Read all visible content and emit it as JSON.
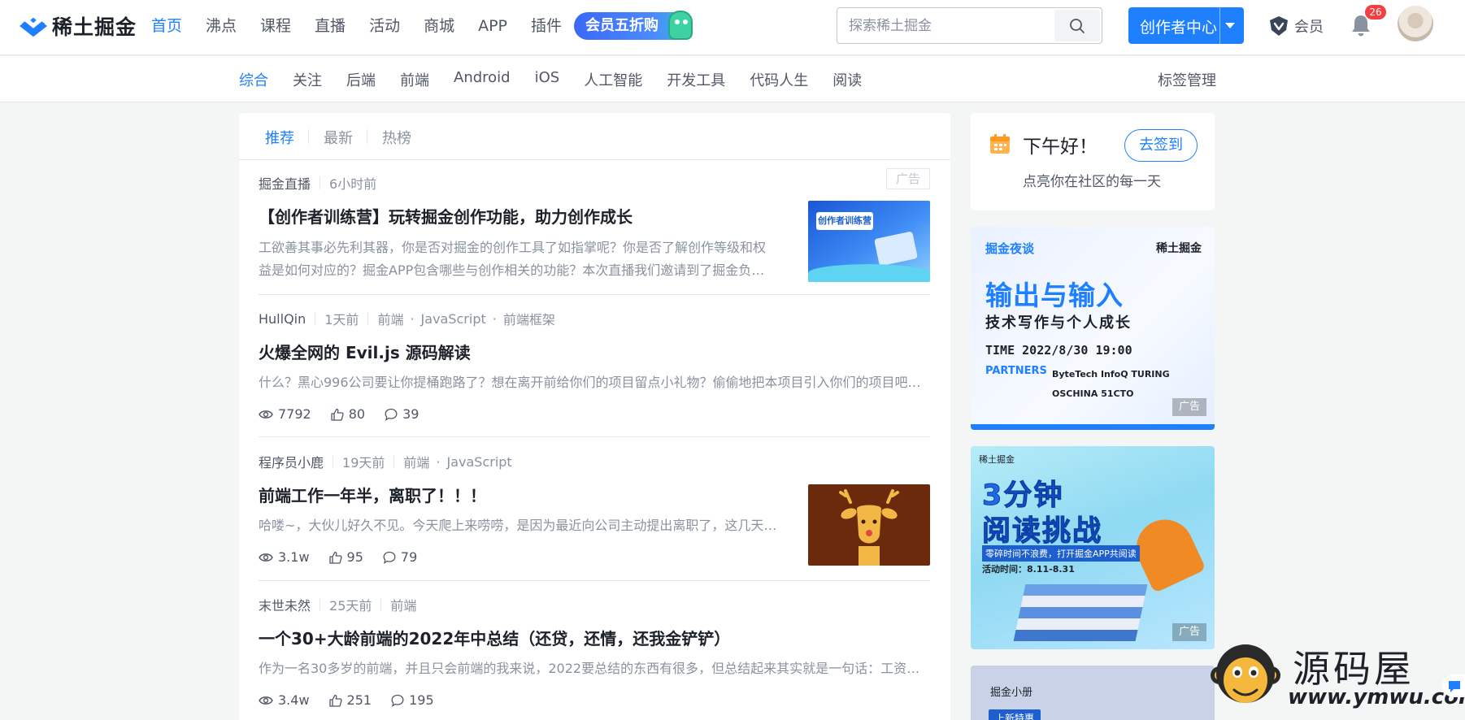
{
  "brand": {
    "name": "稀土掘金",
    "accent": "#1e80ff"
  },
  "main_nav": [
    {
      "label": "首页",
      "active": true
    },
    {
      "label": "沸点"
    },
    {
      "label": "课程"
    },
    {
      "label": "直播"
    },
    {
      "label": "活动"
    },
    {
      "label": "商城"
    },
    {
      "label": "APP"
    },
    {
      "label": "插件"
    }
  ],
  "promo": {
    "label": "会员五折购"
  },
  "search": {
    "placeholder": "探索稀土掘金",
    "icon": "search-icon"
  },
  "creator": {
    "label": "创作者中心"
  },
  "member": {
    "label": "会员"
  },
  "notifications": {
    "count": "26"
  },
  "sub_nav": {
    "items": [
      {
        "label": "综合",
        "active": true
      },
      {
        "label": "关注"
      },
      {
        "label": "后端"
      },
      {
        "label": "前端"
      },
      {
        "label": "Android"
      },
      {
        "label": "iOS"
      },
      {
        "label": "人工智能"
      },
      {
        "label": "开发工具"
      },
      {
        "label": "代码人生"
      },
      {
        "label": "阅读"
      }
    ],
    "manage": "标签管理"
  },
  "feed": {
    "tabs": [
      {
        "label": "推荐",
        "active": true
      },
      {
        "label": "最新"
      },
      {
        "label": "热榜"
      }
    ],
    "entries": [
      {
        "author": "掘金直播",
        "time": "6小时前",
        "ad": "广告",
        "title": "【创作者训练营】玩转掘金创作功能，助力创作成长",
        "abstract_line1": "工欲善其事必先利其器，你是否对掘金的创作工具了如指掌呢？你是否了解创作等级和权",
        "abstract_line2": "益是如何对应的？掘金APP包含哪些与创作相关的功能？本次直播我们邀请到了掘金负…"
      },
      {
        "author": "HullQin",
        "time": "1天前",
        "tags": [
          "前端",
          "JavaScript",
          "前端框架"
        ],
        "title": "火爆全网的 Evil.js 源码解读",
        "abstract_line1": "什么？黑心996公司要让你提桶跑路了？想在离开前给你们的项目留点小礼物？偷偷地把本项目引入你们的项目吧…",
        "views": "7792",
        "likes": "80",
        "comments": "39"
      },
      {
        "author": "程序员小鹿",
        "time": "19天前",
        "tags": [
          "前端",
          "JavaScript"
        ],
        "title": "前端工作一年半，离职了！！！",
        "abstract_line1": "哈喽~，大伙儿好久不见。今天爬上来唠唠，是因为最近向公司主动提出离职了，这几天…",
        "views": "3.1w",
        "likes": "95",
        "comments": "79"
      },
      {
        "author": "末世未然",
        "time": "25天前",
        "tags": [
          "前端"
        ],
        "title": "一个30+大龄前端的2022年中总结（还贷，还情，还我金铲铲）",
        "abstract_line1": "作为一名30多岁的前端，并且只会前端的我来说，2022要总结的东西有很多，但总结起来其实就是一句话：工资…",
        "views": "3.4w",
        "likes": "251",
        "comments": "195"
      }
    ],
    "thumb1": {
      "top_label": "创作者训练营"
    }
  },
  "signin": {
    "greeting": "下午好！",
    "sub": "点亮你在社区的每一天",
    "button": "去签到"
  },
  "banners": {
    "b1": {
      "kicker": "掘金夜谈",
      "brand": "稀土掘金",
      "head": "输出与输入",
      "sub": "技术写作与个人成长",
      "time": "TIME 2022/8/30 19:00",
      "partners": "PARTNERS",
      "logos": "ByteTech  InfoQ  TURING  OSCHINA  51CTO",
      "ad": "广告"
    },
    "b2": {
      "brand": "稀土掘金",
      "head1": "3分钟",
      "head2": "阅读挑战",
      "sub": "零碎时间不浪费，打开掘金APP共阅读",
      "date": "活动时间：8.11-8.31",
      "ad": "广告"
    },
    "b3": {
      "brand": "掘金小册",
      "pill": "上新特惠"
    }
  },
  "watermark": {
    "name": "源码屋",
    "url": "www.ymwu.com"
  }
}
